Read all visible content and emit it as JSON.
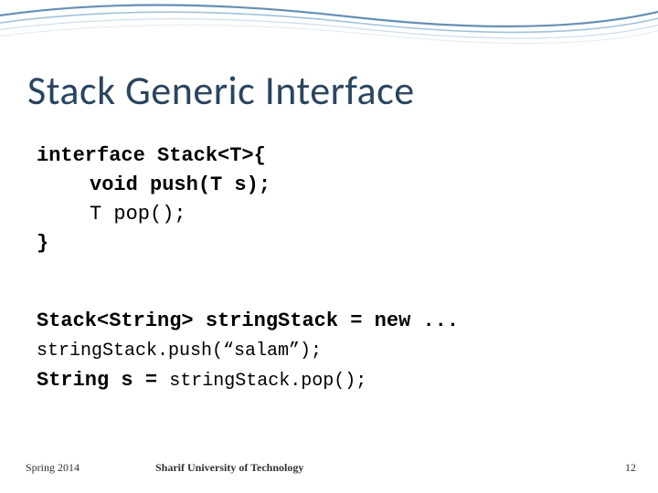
{
  "title": "Stack Generic Interface",
  "code1": {
    "l1": "interface Stack<T>{",
    "l2": "void push(T s);",
    "l3_a": "T pop();",
    "l4": "}"
  },
  "code2": {
    "l1": "Stack<String> stringStack = new ...",
    "l2": "stringStack.push(“salam”);",
    "l3_a": "String s = ",
    "l3_b": "stringStack.pop();"
  },
  "footer": {
    "left": "Spring 2014",
    "center": "Sharif University of Technology",
    "right": "12"
  }
}
